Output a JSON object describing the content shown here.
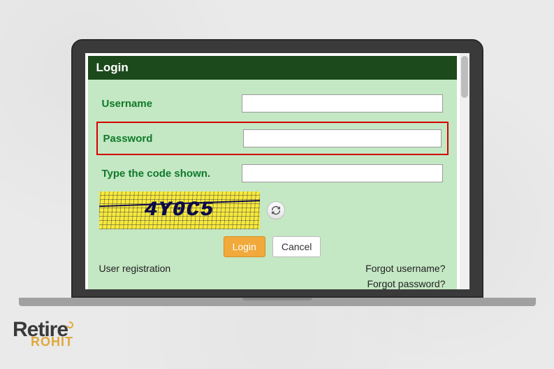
{
  "header": {
    "title": "Login"
  },
  "fields": {
    "username": {
      "label": "Username",
      "value": ""
    },
    "password": {
      "label": "Password",
      "value": ""
    },
    "captcha": {
      "label": "Type the code shown.",
      "value": "",
      "code": "4Y0C5"
    }
  },
  "buttons": {
    "login": "Login",
    "cancel": "Cancel"
  },
  "links": {
    "register": "User registration",
    "forgot_username": "Forgot username?",
    "forgot_password": "Forgot password?"
  },
  "watermark": {
    "line1": "Retire",
    "line2": "ROHIT"
  }
}
